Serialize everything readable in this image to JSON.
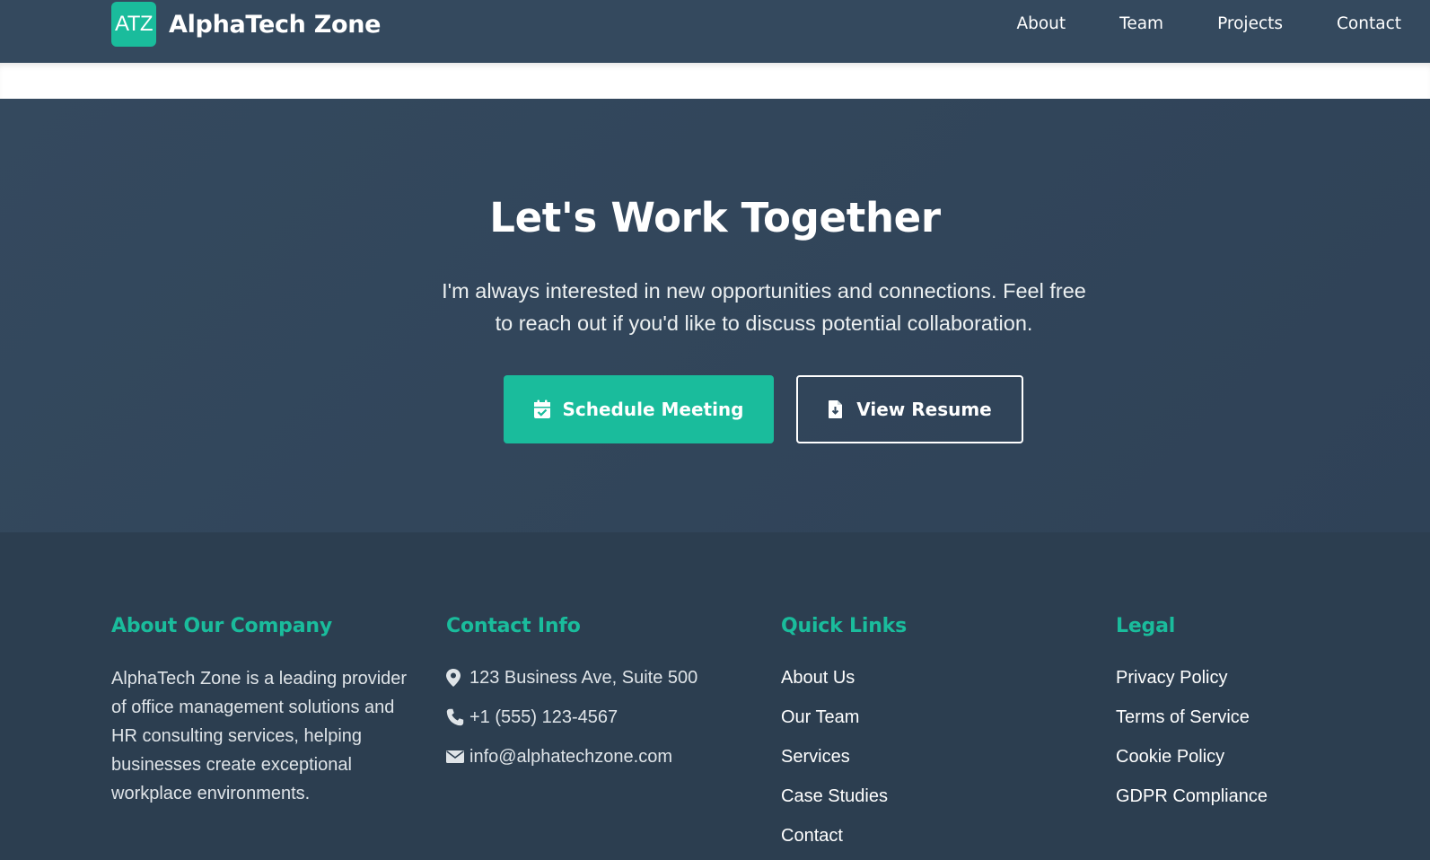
{
  "nav": {
    "logo_text": "ATZ",
    "brand": "AlphaTech Zone",
    "links": [
      "About",
      "Team",
      "Projects",
      "Contact"
    ]
  },
  "cta": {
    "title": "Let's Work Together",
    "text": "I'm always interested in new opportunities and connections. Feel free to reach out if you'd like to discuss potential collaboration.",
    "primary_button": {
      "label": "Schedule Meeting",
      "icon": "calendar-check-icon"
    },
    "secondary_button": {
      "label": "View Resume",
      "icon": "file-download-icon"
    }
  },
  "footer": {
    "about": {
      "title": "About Our Company",
      "text": "AlphaTech Zone is a leading provider of office management solutions and HR consulting services, helping businesses create exceptional workplace environments."
    },
    "contact": {
      "title": "Contact Info",
      "address": "123 Business Ave, Suite 500",
      "phone": "+1 (555) 123-4567",
      "email": "info@alphatechzone.com"
    },
    "quick_links": {
      "title": "Quick Links",
      "items": [
        "About Us",
        "Our Team",
        "Services",
        "Case Studies",
        "Contact"
      ]
    },
    "legal": {
      "title": "Legal",
      "items": [
        "Privacy Policy",
        "Terms of Service",
        "Cookie Policy",
        "GDPR Compliance"
      ]
    }
  },
  "colors": {
    "accent": "#1abc9c",
    "nav_bg": "#34495e",
    "footer_bg": "#2c3e50"
  }
}
